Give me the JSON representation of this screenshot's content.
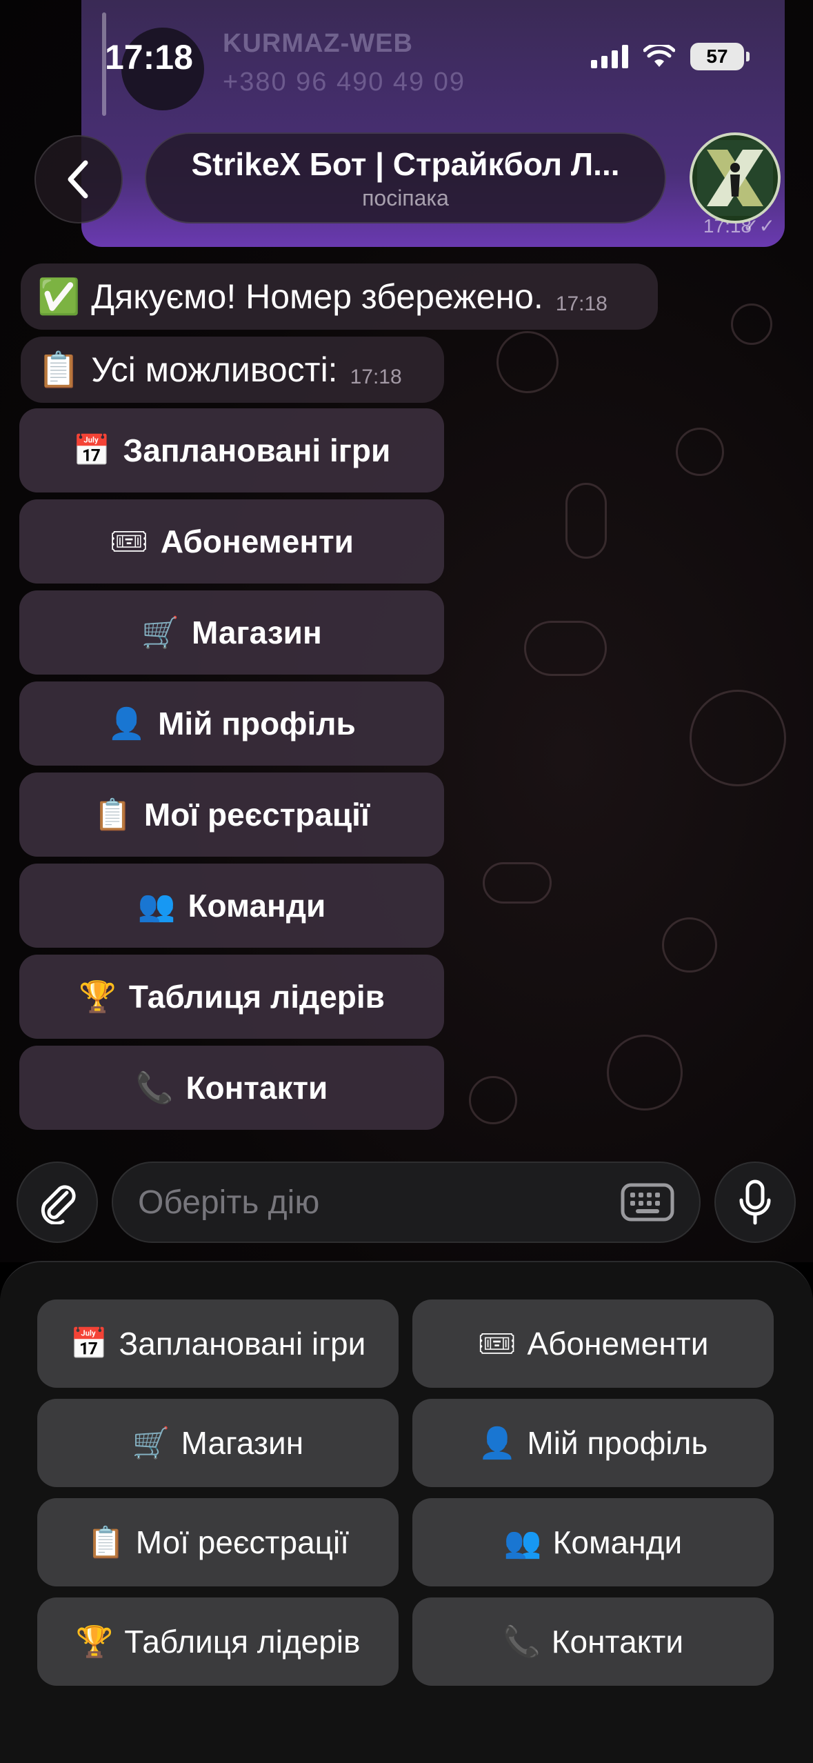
{
  "status_bar": {
    "time": "17:18",
    "battery": "57"
  },
  "previous_message": {
    "sender": "KURMAZ-WEB",
    "phone": "+380 96 490 49 09",
    "time": "17:18"
  },
  "header": {
    "title": "StrikeX Бот | Страйкбол Л...",
    "subtitle": "посіпака"
  },
  "messages": [
    {
      "icon": "✅",
      "text": "Дякуємо! Номер збережено.",
      "time": "17:18"
    },
    {
      "icon": "📋",
      "text": "Усі можливості:",
      "time": "17:18"
    }
  ],
  "inline_keyboard": [
    {
      "icon": "📅",
      "label": "Заплановані ігри"
    },
    {
      "icon": "🎟",
      "label": "Абонементи"
    },
    {
      "icon": "🛒",
      "label": "Магазин"
    },
    {
      "icon": "👤",
      "label": "Мій профіль"
    },
    {
      "icon": "📋",
      "label": "Мої реєстрації"
    },
    {
      "icon": "👥",
      "label": "Команди"
    },
    {
      "icon": "🏆",
      "label": "Таблиця лідерів"
    },
    {
      "icon": "📞",
      "label": "Контакти"
    }
  ],
  "input": {
    "placeholder": "Оберіть дію"
  },
  "reply_keyboard": [
    {
      "icon": "📅",
      "label": "Заплановані ігри"
    },
    {
      "icon": "🎟",
      "label": "Абонементи"
    },
    {
      "icon": "🛒",
      "label": "Магазин"
    },
    {
      "icon": "👤",
      "label": "Мій профіль"
    },
    {
      "icon": "📋",
      "label": "Мої реєстрації"
    },
    {
      "icon": "👥",
      "label": "Команди"
    },
    {
      "icon": "🏆",
      "label": "Таблиця лідерів"
    },
    {
      "icon": "📞",
      "label": "Контакти"
    }
  ],
  "colors": {
    "accent_purple": "#6a3ab0",
    "bubble": "#2c242c",
    "button": "#3a2e3c",
    "keyboard_button": "#3b3b3d"
  }
}
